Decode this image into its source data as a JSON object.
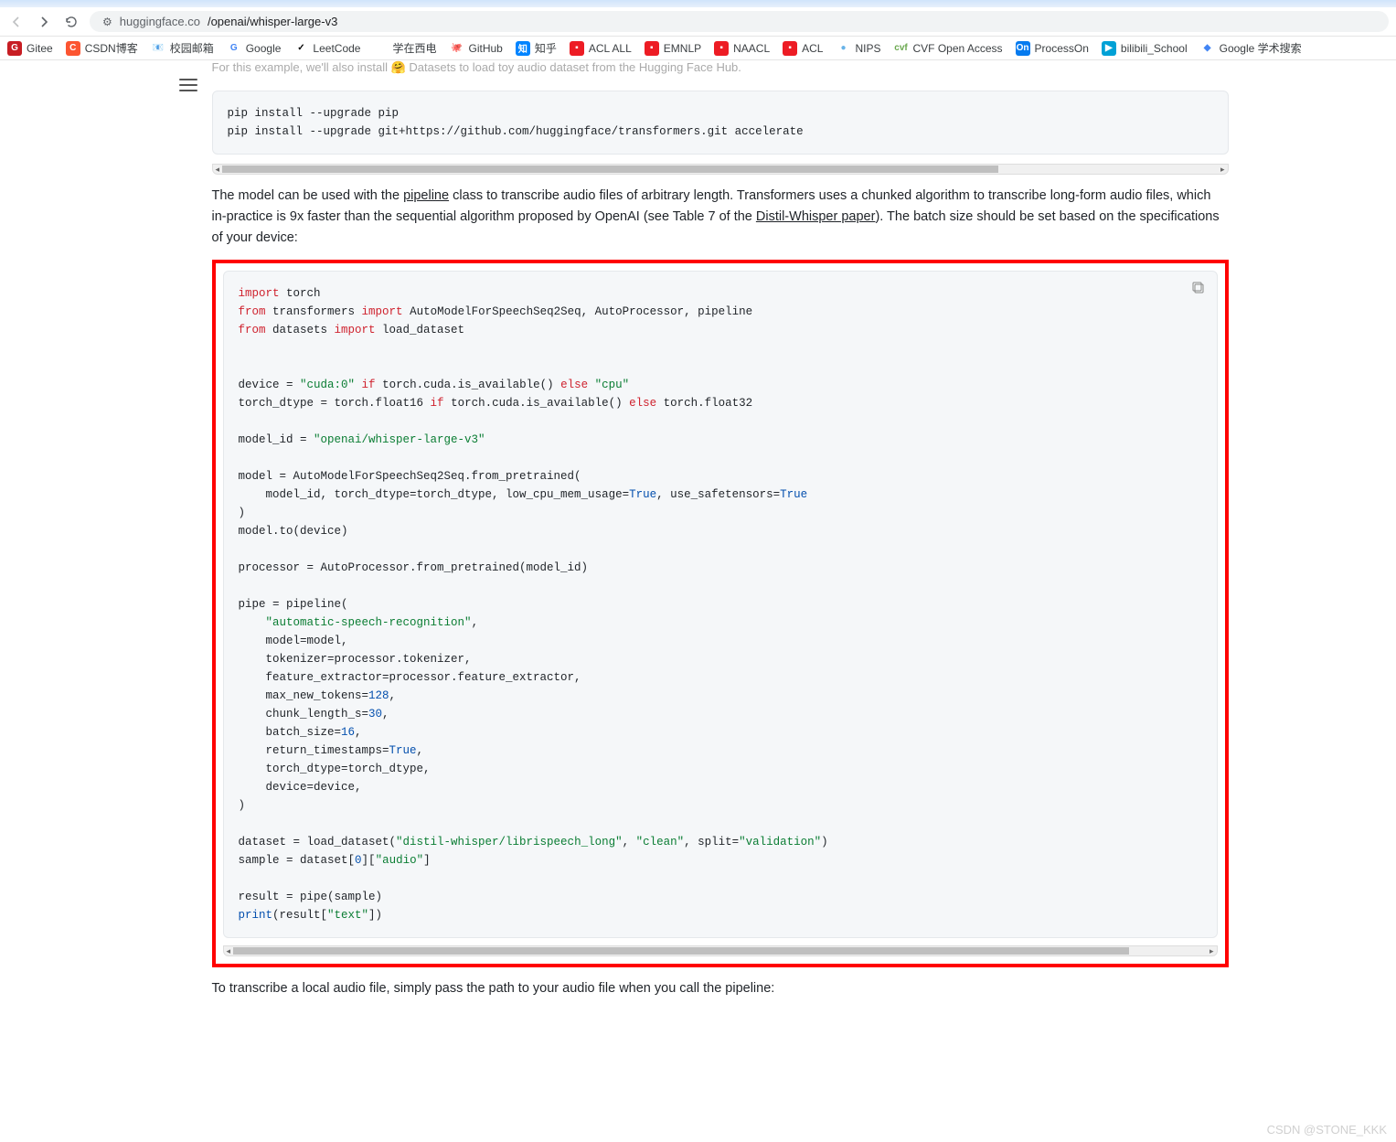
{
  "browser": {
    "url_host": "huggingface.co",
    "url_path": "/openai/whisper-large-v3"
  },
  "bookmarks": [
    {
      "label": "Gitee",
      "bg": "#c71d23"
    },
    {
      "label": "CSDN博客",
      "bg": "#fc5531",
      "text": "C"
    },
    {
      "label": "校园邮箱",
      "bg": "transparent",
      "emoji": "📧"
    },
    {
      "label": "Google",
      "bg": "transparent",
      "text": "G",
      "color": "#4285f4"
    },
    {
      "label": "LeetCode",
      "bg": "transparent",
      "emoji": "✓",
      "color": "#000"
    },
    {
      "label": "学在西电",
      "bg": "transparent"
    },
    {
      "label": "GitHub",
      "bg": "transparent",
      "emoji": "🐙",
      "color": "#000"
    },
    {
      "label": "知乎",
      "bg": "#0084ff",
      "text": "知"
    },
    {
      "label": "ACL ALL",
      "bg": "#ed1c24",
      "text": "▪"
    },
    {
      "label": "EMNLP",
      "bg": "#ed1c24",
      "text": "▪"
    },
    {
      "label": "NAACL",
      "bg": "#ed1c24",
      "text": "▪"
    },
    {
      "label": "ACL",
      "bg": "#ed1c24",
      "text": "▪"
    },
    {
      "label": "NIPS",
      "bg": "transparent",
      "emoji": "●",
      "color": "#68b3e8"
    },
    {
      "label": "CVF Open Access",
      "bg": "transparent",
      "text": "cvf",
      "color": "#6aa84f"
    },
    {
      "label": "ProcessOn",
      "bg": "#067bef",
      "text": "On"
    },
    {
      "label": "bilibili_School",
      "bg": "#00a1d6",
      "emoji": "▶"
    },
    {
      "label": "Google 学术搜索",
      "bg": "transparent",
      "emoji": "◆",
      "color": "#4285f4"
    }
  ],
  "content": {
    "partial_line": "For this example, we'll also install 🤗 Datasets to load toy audio dataset from the Hugging Face Hub.",
    "code1": "pip install --upgrade pip\npip install --upgrade git+https://github.com/huggingface/transformers.git accelerate",
    "para1_pre": "The model can be used with the ",
    "para1_link": "pipeline",
    "para1_post": " class to transcribe audio files of arbitrary length. Transformers uses a chunked algorithm to transcribe long-form audio files, which in-practice is 9x faster than the sequential algorithm proposed by OpenAI (see Table 7 of the ",
    "para1_link2": "Distil-Whisper paper",
    "para1_post2": "). The batch size should be set based on the specifications of your device:",
    "para_final": "To transcribe a local audio file, simply pass the path to your audio file when you call the pipeline:",
    "code2_tokens": [
      {
        "t": "import",
        "c": "kw-import"
      },
      {
        "t": " torch\n"
      },
      {
        "t": "from",
        "c": "kw-from"
      },
      {
        "t": " transformers "
      },
      {
        "t": "import",
        "c": "kw-import"
      },
      {
        "t": " AutoModelForSpeechSeq2Seq, AutoProcessor, pipeline\n"
      },
      {
        "t": "from",
        "c": "kw-from"
      },
      {
        "t": " datasets "
      },
      {
        "t": "import",
        "c": "kw-import"
      },
      {
        "t": " load_dataset\n"
      },
      {
        "t": "\n\n"
      },
      {
        "t": "device = "
      },
      {
        "t": "\"cuda:0\"",
        "c": "str"
      },
      {
        "t": " "
      },
      {
        "t": "if",
        "c": "kw-if"
      },
      {
        "t": " torch.cuda.is_available() "
      },
      {
        "t": "else",
        "c": "kw-else"
      },
      {
        "t": " "
      },
      {
        "t": "\"cpu\"",
        "c": "str"
      },
      {
        "t": "\n"
      },
      {
        "t": "torch_dtype = torch.float16 "
      },
      {
        "t": "if",
        "c": "kw-if"
      },
      {
        "t": " torch.cuda.is_available() "
      },
      {
        "t": "else",
        "c": "kw-else"
      },
      {
        "t": " torch.float32\n"
      },
      {
        "t": "\n"
      },
      {
        "t": "model_id = "
      },
      {
        "t": "\"openai/whisper-large-v3\"",
        "c": "str"
      },
      {
        "t": "\n"
      },
      {
        "t": "\n"
      },
      {
        "t": "model = AutoModelForSpeechSeq2Seq.from_pretrained(\n"
      },
      {
        "t": "    model_id, torch_dtype=torch_dtype, low_cpu_mem_usage="
      },
      {
        "t": "True",
        "c": "bool"
      },
      {
        "t": ", use_safetensors="
      },
      {
        "t": "True",
        "c": "bool"
      },
      {
        "t": "\n"
      },
      {
        "t": ")\n"
      },
      {
        "t": "model.to(device)\n"
      },
      {
        "t": "\n"
      },
      {
        "t": "processor = AutoProcessor.from_pretrained(model_id)\n"
      },
      {
        "t": "\n"
      },
      {
        "t": "pipe = pipeline(\n"
      },
      {
        "t": "    "
      },
      {
        "t": "\"automatic-speech-recognition\"",
        "c": "str"
      },
      {
        "t": ",\n"
      },
      {
        "t": "    model=model,\n"
      },
      {
        "t": "    tokenizer=processor.tokenizer,\n"
      },
      {
        "t": "    feature_extractor=processor.feature_extractor,\n"
      },
      {
        "t": "    max_new_tokens="
      },
      {
        "t": "128",
        "c": "num"
      },
      {
        "t": ",\n"
      },
      {
        "t": "    chunk_length_s="
      },
      {
        "t": "30",
        "c": "num"
      },
      {
        "t": ",\n"
      },
      {
        "t": "    batch_size="
      },
      {
        "t": "16",
        "c": "num"
      },
      {
        "t": ",\n"
      },
      {
        "t": "    return_timestamps="
      },
      {
        "t": "True",
        "c": "bool"
      },
      {
        "t": ",\n"
      },
      {
        "t": "    torch_dtype=torch_dtype,\n"
      },
      {
        "t": "    device=device,\n"
      },
      {
        "t": ")\n"
      },
      {
        "t": "\n"
      },
      {
        "t": "dataset = load_dataset("
      },
      {
        "t": "\"distil-whisper/librispeech_long\"",
        "c": "str"
      },
      {
        "t": ", "
      },
      {
        "t": "\"clean\"",
        "c": "str"
      },
      {
        "t": ", split="
      },
      {
        "t": "\"validation\"",
        "c": "str"
      },
      {
        "t": ")\n"
      },
      {
        "t": "sample = dataset["
      },
      {
        "t": "0",
        "c": "num"
      },
      {
        "t": "]["
      },
      {
        "t": "\"audio\"",
        "c": "str"
      },
      {
        "t": "]\n"
      },
      {
        "t": "\n"
      },
      {
        "t": "result = pipe(sample)\n"
      },
      {
        "t": "print",
        "c": "kw-builtin"
      },
      {
        "t": "(result["
      },
      {
        "t": "\"text\"",
        "c": "str"
      },
      {
        "t": "])"
      }
    ]
  },
  "watermark": "CSDN @STONE_KKK"
}
